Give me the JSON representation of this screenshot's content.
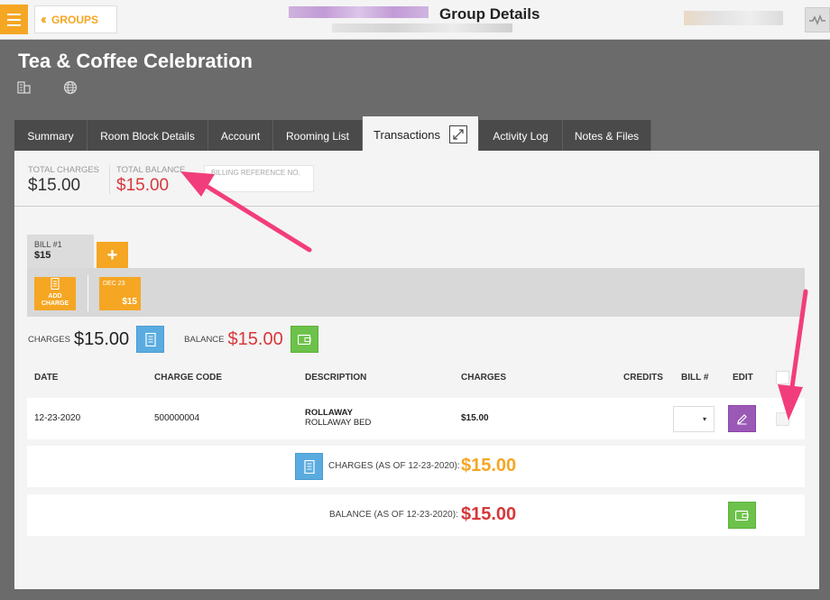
{
  "header": {
    "menu_icon": "hamburger-icon",
    "back_label": "GROUPS",
    "title": "Group Details",
    "activity_icon": "pulse-icon",
    "brand_color": "#f5a623"
  },
  "group": {
    "name": "Tea & Coffee Celebration",
    "icons": [
      "building-icon",
      "globe-icon"
    ]
  },
  "tabs": [
    {
      "label": "Summary",
      "active": false
    },
    {
      "label": "Room Block Details",
      "active": false
    },
    {
      "label": "Account",
      "active": false
    },
    {
      "label": "Rooming List",
      "active": false
    },
    {
      "label": "Transactions",
      "active": true
    },
    {
      "label": "Activity Log",
      "active": false
    },
    {
      "label": "Notes & Files",
      "active": false
    }
  ],
  "totals": {
    "total_charges_label": "TOTAL CHARGES",
    "total_charges_value": "$15.00",
    "total_balance_label": "TOTAL BALANCE",
    "total_balance_value": "$15.00",
    "billing_ref_placeholder": "BILLING REFERENCE NO."
  },
  "bill": {
    "tab_label": "BILL #1",
    "tab_amount": "$15",
    "add_bill_label": "+",
    "add_charge_label_1": "ADD",
    "add_charge_label_2": "CHARGE",
    "date_chip_date": "DEC 23",
    "date_chip_amount": "$15"
  },
  "summary": {
    "charges_label": "CHARGES",
    "charges_value": "$15.00",
    "balance_label": "BALANCE",
    "balance_value": "$15.00"
  },
  "table": {
    "headers": [
      "DATE",
      "CHARGE CODE",
      "DESCRIPTION",
      "CHARGES",
      "CREDITS",
      "BILL #",
      "EDIT"
    ],
    "rows": [
      {
        "date": "12-23-2020",
        "charge_code": "500000004",
        "description_title": "ROLLAWAY",
        "description_sub": "ROLLAWAY BED",
        "charges": "$15.00",
        "credits": "",
        "bill_select_arrow": "▾"
      }
    ]
  },
  "footer_totals": {
    "charges_label": "CHARGES (AS OF 12-23-2020):",
    "charges_value": "$15.00",
    "balance_label": "BALANCE (AS OF 12-23-2020):",
    "balance_value": "$15.00"
  },
  "colors": {
    "accent": "#f5a623",
    "negative": "#d8373a",
    "annotation_arrow": "#f23d7c"
  }
}
